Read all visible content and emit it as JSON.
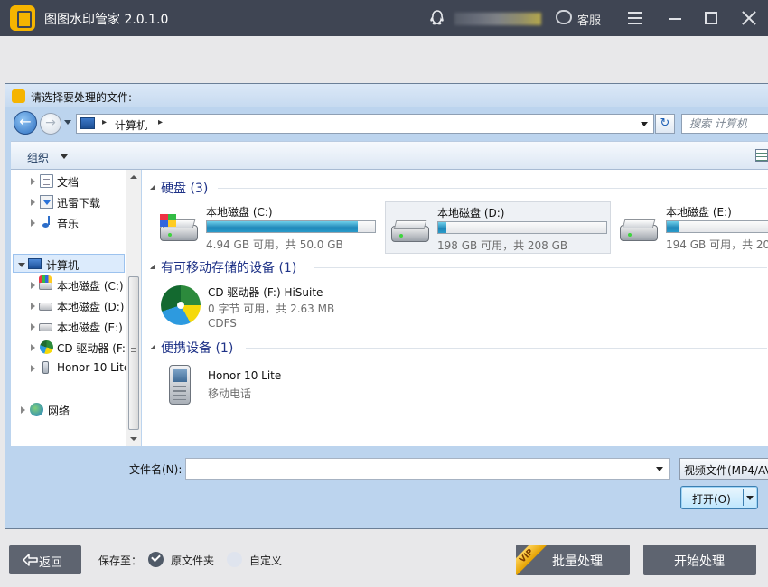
{
  "app": {
    "title": "图图水印管家  2.0.1.0",
    "service_label": "客服"
  },
  "dialog": {
    "title": "请选择要处理的文件:",
    "address": {
      "crumb": "计算机"
    },
    "search_placeholder": "搜索 计算机",
    "organize_label": "组织",
    "nav_items": [
      {
        "label": "文档",
        "icon": "document-icon"
      },
      {
        "label": "迅雷下载",
        "icon": "download-folder-icon"
      },
      {
        "label": "音乐",
        "icon": "music-icon"
      },
      {
        "label": "计算机",
        "icon": "computer-icon",
        "selected": true
      },
      {
        "label": "本地磁盘 (C:)",
        "icon": "system-drive-icon"
      },
      {
        "label": "本地磁盘 (D:)",
        "icon": "drive-icon"
      },
      {
        "label": "本地磁盘 (E:)",
        "icon": "drive-icon"
      },
      {
        "label": "CD 驱动器 (F:",
        "icon": "cd-drive-icon"
      },
      {
        "label": "Honor 10 Lite",
        "icon": "phone-icon"
      },
      {
        "label": "网络",
        "icon": "network-icon"
      }
    ],
    "groups": {
      "hard_disks": "硬盘 (3)",
      "removable": "有可移动存储的设备 (1)",
      "portable": "便携设备 (1)"
    },
    "drives": [
      {
        "name": "本地磁盘 (C:)",
        "space": "4.94 GB 可用，共 50.0 GB",
        "used_fraction": 0.9
      },
      {
        "name": "本地磁盘 (D:)",
        "space": "198 GB 可用，共 208 GB",
        "used_fraction": 0.05
      },
      {
        "name": "本地磁盘 (E:)",
        "space": "194 GB 可用，共 20",
        "used_fraction": 0.07
      }
    ],
    "cd": {
      "name": "CD 驱动器 (F:) HiSuite",
      "space": "0 字节 可用，共 2.63 MB",
      "fs": "CDFS"
    },
    "phone": {
      "name": "Honor 10 Lite",
      "type": "移动电话"
    },
    "filename_label": "文件名(N):",
    "filename_value": "",
    "filetype": "视频文件(MP4/AV",
    "open_label": "打开(O)"
  },
  "bottom": {
    "back_label": "返回",
    "save_to_label": "保存至：",
    "option_original": "原文件夹",
    "option_custom": "自定义",
    "vip_tag": "VIP",
    "batch_label": "批量处理",
    "start_label": "开始处理"
  }
}
